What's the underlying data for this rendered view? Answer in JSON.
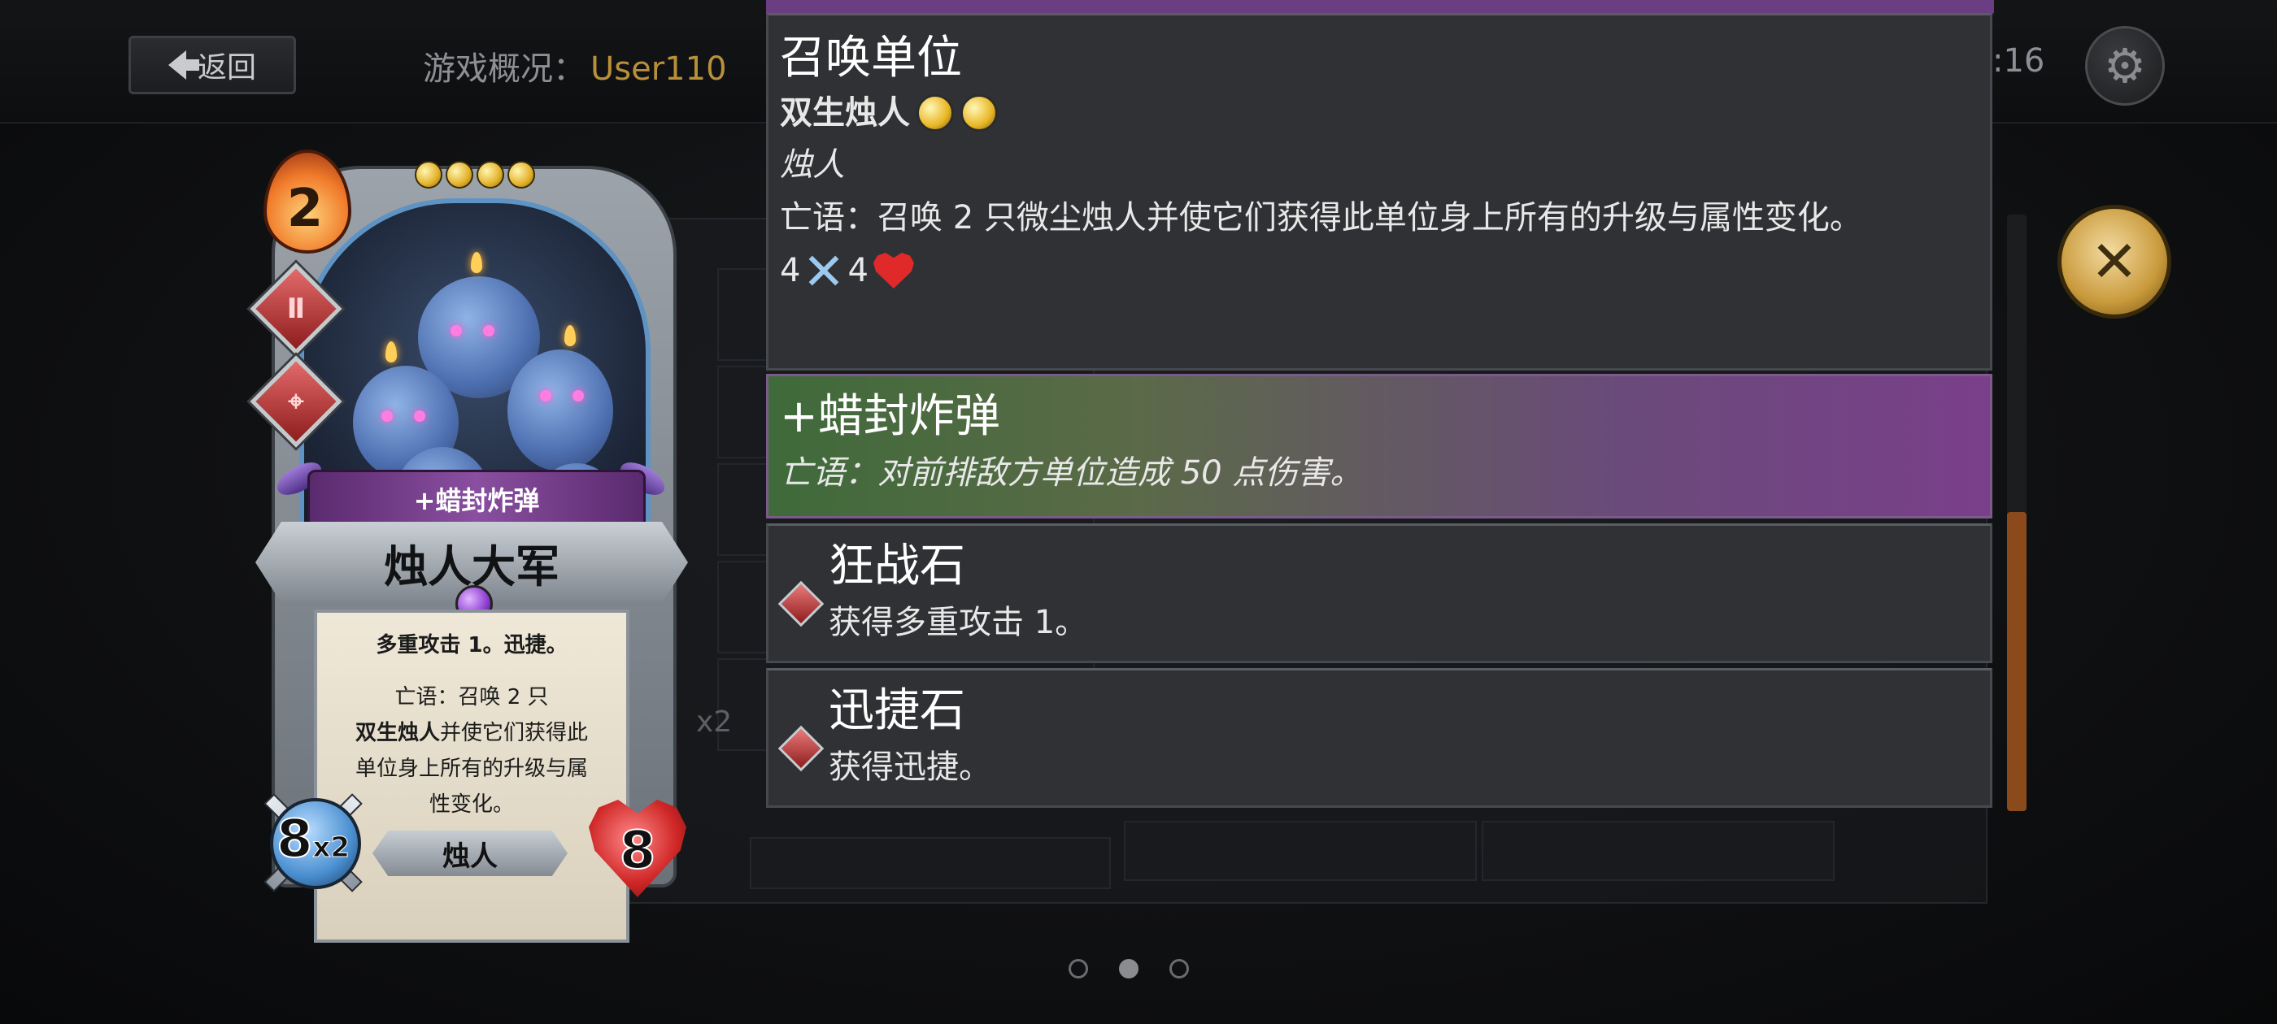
{
  "topbar": {
    "back_label": "返回",
    "overview_label": "游戏概况：",
    "user_name": "User110",
    "time_fragment": ":16"
  },
  "board": {
    "x2_label": "x2"
  },
  "card": {
    "cost": "2",
    "upgrade_name": "+蜡封炸弹",
    "name": "烛人大军",
    "ability_line": "多重攻击 1。迅捷。",
    "deathrattle_prefix": "亡语：召唤 2 只",
    "deathrattle_unit": "双生烛人",
    "deathrattle_rest_1": "并使它们获得此",
    "deathrattle_rest_2": "单位身上所有的升级与属",
    "deathrattle_rest_3": "性变化。",
    "attack": "8",
    "attack_multiplier": "x2",
    "tribe": "烛人",
    "health": "8"
  },
  "detail": {
    "summon": {
      "title": "召唤单位",
      "unit_name": "双生烛人",
      "unit_rarity": 2,
      "tribe": "烛人",
      "desc": "亡语：召唤 2 只微尘烛人并使它们获得此单位身上所有的升级与属性变化。",
      "attack": "4",
      "health": "4"
    },
    "upgrade": {
      "title": "+蜡封炸弹",
      "desc": "亡语：对前排敌方单位造成 50 点伤害。"
    },
    "berserk_stone": {
      "title": "狂战石",
      "desc": "获得多重攻击 1。"
    },
    "swift_stone": {
      "title": "迅捷石",
      "desc": "获得迅捷。"
    }
  },
  "pagination": {
    "pages": 3,
    "active": 2
  },
  "colors": {
    "accent_gold": "#c99a3c",
    "upgrade_purple": "#7a3f8a",
    "user_gold": "#b8903a",
    "scroll_thumb": "#8a4a1c"
  },
  "icons": {
    "back": "arrow-left-icon",
    "settings": "gear-icon",
    "close": "close-icon",
    "attack": "crossed-swords-icon",
    "health": "heart-icon",
    "cost": "flame-icon",
    "rarity": "gold-coin-icon",
    "stone": "red-gem-icon"
  }
}
